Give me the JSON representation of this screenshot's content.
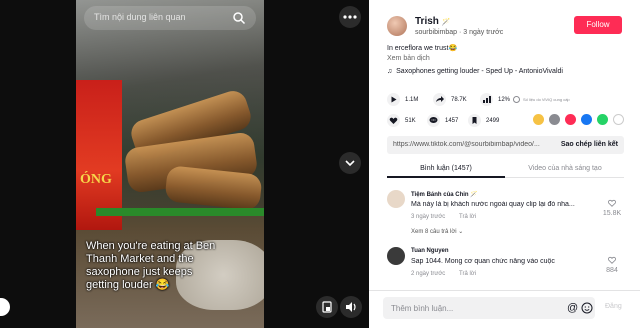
{
  "search": {
    "placeholder": "Tìm nội dung liên quan"
  },
  "video": {
    "caption": "When you're eating at Ben Thanh Market and the saxophone just keeps getting louder 😂",
    "sign_text": "ÓNG"
  },
  "author": {
    "name": "Trish",
    "name_badge": "🪄",
    "handle_date": "sourbibimbap · 3 ngày trước",
    "follow_label": "Follow"
  },
  "post": {
    "description": "In erceflora we trust😂",
    "translate_label": "Xem bản dịch",
    "music": "Saxophones getting louder - Sped Up - AntonioVivaldi"
  },
  "stats": {
    "plays": "1.1M",
    "shares": "78.7K",
    "percent": "12%",
    "note": "Số liệu do ViVIQ cung cấp",
    "likes": "51K",
    "comments": "1457",
    "saves": "2499"
  },
  "link": {
    "url": "https://www.tiktok.com/@sourbibimbap/video/...",
    "copy_label": "Sao chép liên kết"
  },
  "tabs": {
    "comments": "Bình luận (1457)",
    "creator_videos": "Video của nhà sáng tạo"
  },
  "comments": [
    {
      "name": "Tiệm Bánh của Chin 🪄",
      "text": "Mà này là bị khách nước ngoài quay clip lại đó nha...",
      "date": "3 ngày trước",
      "reply": "Trả lời",
      "more": "Xem 8 câu trả lời ⌄",
      "likes": "15.8K"
    },
    {
      "name": "Tuan Nguyen",
      "text": "Sap 1044. Mong cơ quan chức năng vào cuộc",
      "date": "2 ngày trước",
      "reply": "Trả lời",
      "likes": "884"
    }
  ],
  "comment_bar": {
    "placeholder": "Thêm bình luận...",
    "post_label": "Đăng"
  },
  "colors": {
    "accent": "#fe2c55",
    "text": "#161823",
    "muted": "#8a8b91"
  }
}
